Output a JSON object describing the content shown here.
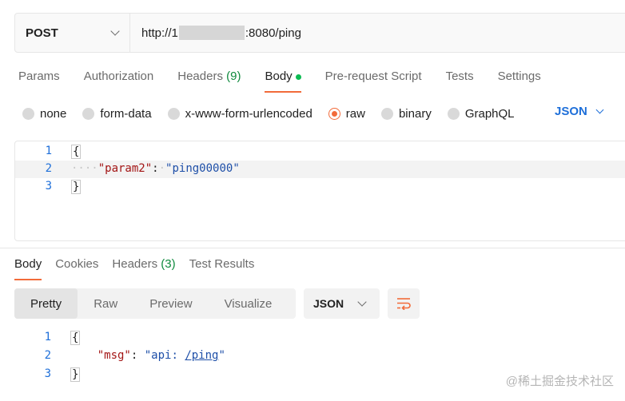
{
  "request": {
    "method": "POST",
    "url_prefix": "http://1",
    "url_suffix": ":8080/ping"
  },
  "request_tabs": [
    {
      "label": "Params"
    },
    {
      "label": "Authorization"
    },
    {
      "label": "Headers",
      "count": "(9)"
    },
    {
      "label": "Body",
      "active": true
    },
    {
      "label": "Pre-request Script"
    },
    {
      "label": "Tests"
    },
    {
      "label": "Settings"
    }
  ],
  "body_types": [
    "none",
    "form-data",
    "x-www-form-urlencoded",
    "raw",
    "binary",
    "GraphQL"
  ],
  "body_type_selected": "raw",
  "body_language": "JSON",
  "request_body": {
    "line_numbers": [
      "1",
      "2",
      "3"
    ],
    "open_brace": "{",
    "close_brace": "}",
    "key": "\"param2\"",
    "colon": ":",
    "value": "\"ping00000\""
  },
  "response_tabs": [
    {
      "label": "Body",
      "active": true
    },
    {
      "label": "Cookies"
    },
    {
      "label": "Headers",
      "count": "(3)"
    },
    {
      "label": "Test Results"
    }
  ],
  "response_views": [
    "Pretty",
    "Raw",
    "Preview",
    "Visualize"
  ],
  "response_view_selected": "Pretty",
  "response_format": "JSON",
  "response_body": {
    "line_numbers": [
      "1",
      "2",
      "3"
    ],
    "open_brace": "{",
    "close_brace": "}",
    "key": "\"msg\"",
    "colon": ":",
    "value_prefix": "\"api: ",
    "value_link": "/ping",
    "value_suffix": "\""
  },
  "watermark": "@稀土掘金技术社区",
  "colors": {
    "accent": "#f26b3a",
    "tab_count": "#0f8a3d",
    "link_blue": "#1e6fd9",
    "json_key": "#a31515"
  }
}
